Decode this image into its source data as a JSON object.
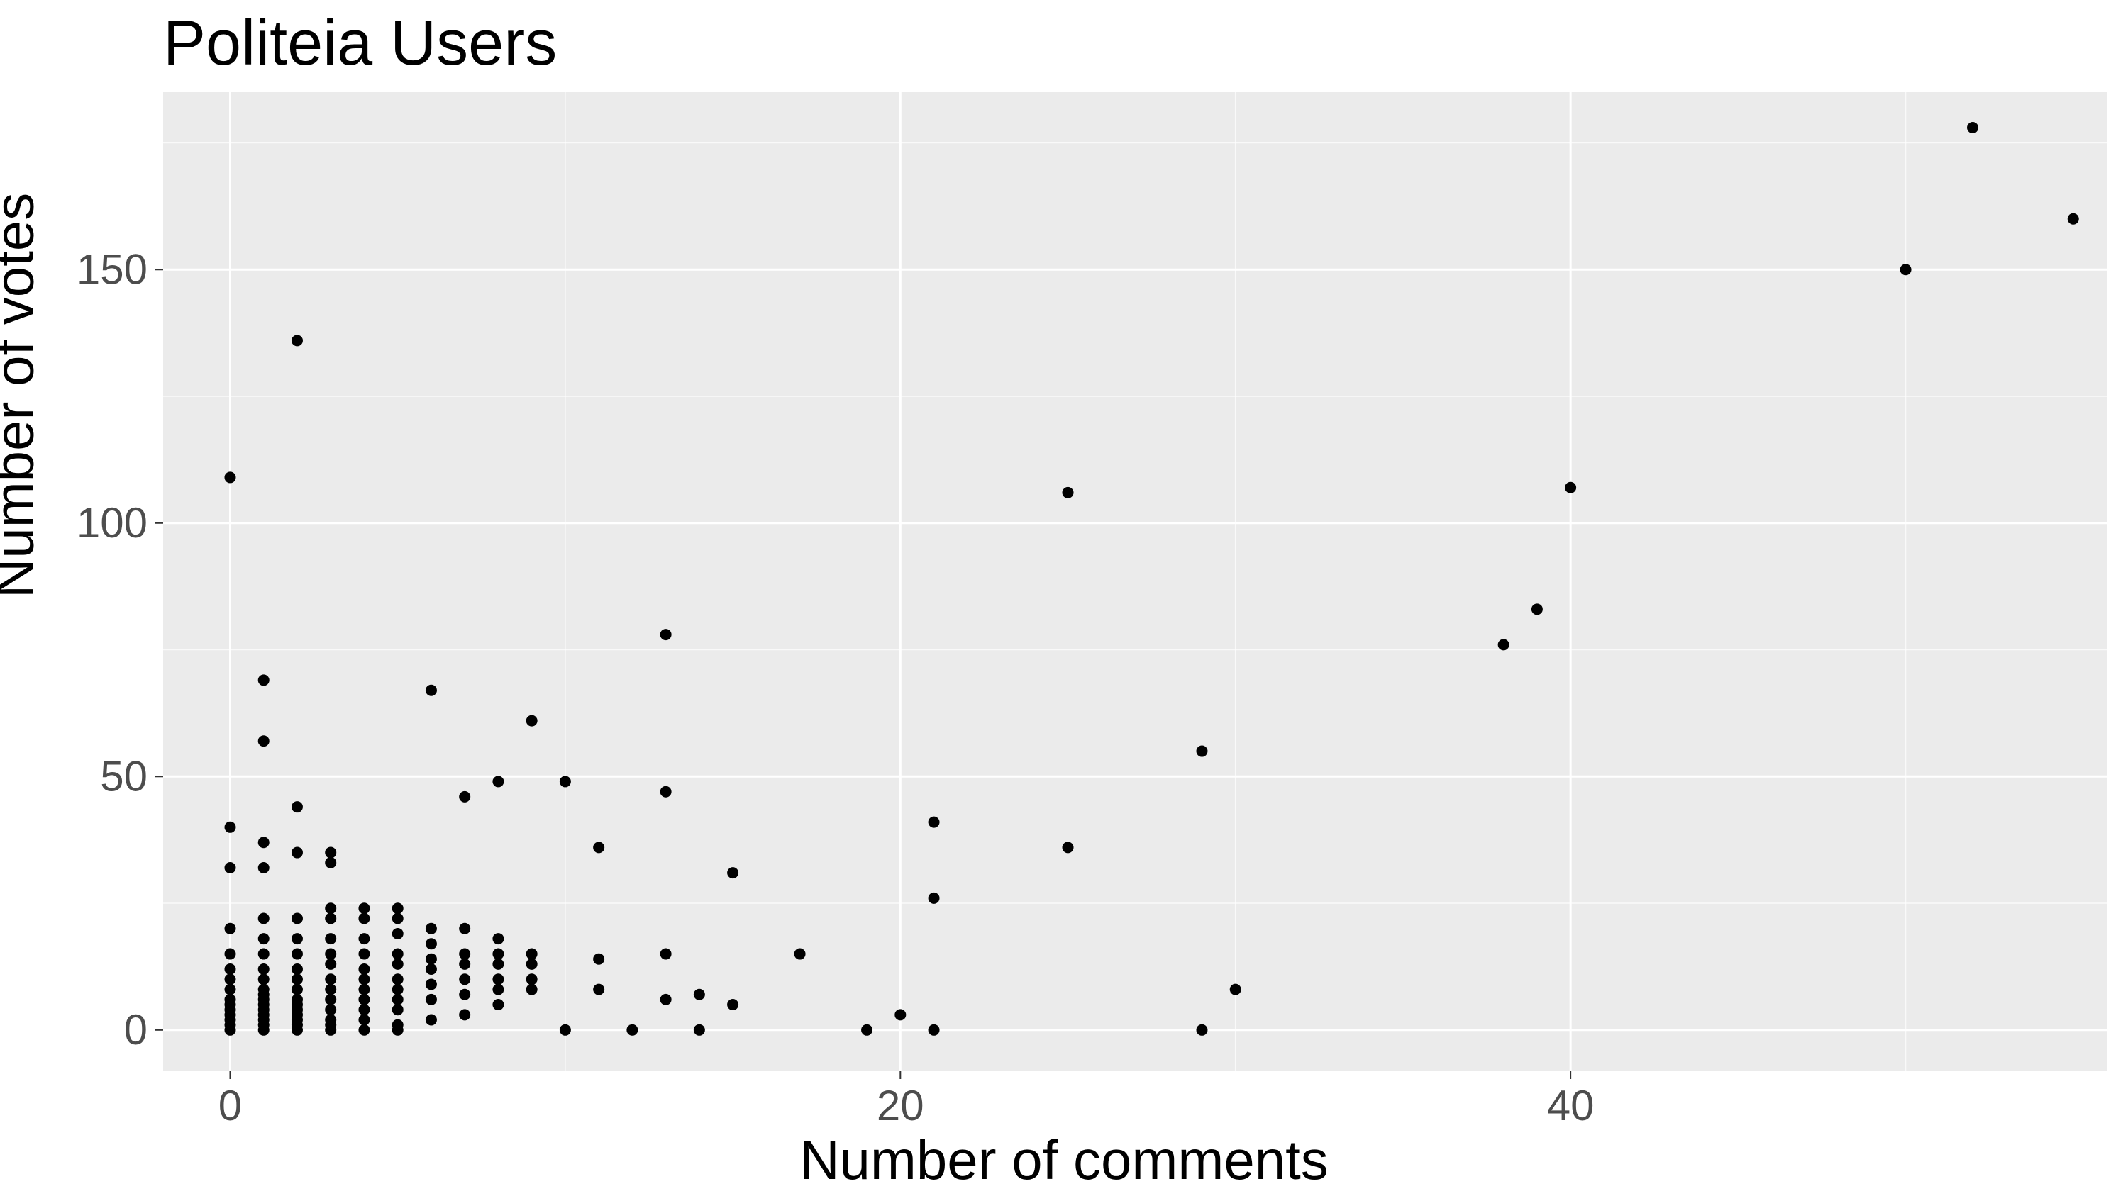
{
  "chart_data": {
    "type": "scatter",
    "title": "Politeia Users",
    "xlabel": "Number of comments",
    "ylabel": "Number of votes",
    "xlim": [
      -2,
      56
    ],
    "ylim": [
      -8,
      185
    ],
    "x_ticks": [
      0,
      20,
      40
    ],
    "y_ticks": [
      0,
      50,
      100,
      150
    ],
    "points": [
      {
        "x": 0,
        "y": 109
      },
      {
        "x": 0,
        "y": 40
      },
      {
        "x": 0,
        "y": 32
      },
      {
        "x": 0,
        "y": 20
      },
      {
        "x": 0,
        "y": 15
      },
      {
        "x": 0,
        "y": 12
      },
      {
        "x": 0,
        "y": 10
      },
      {
        "x": 0,
        "y": 8
      },
      {
        "x": 0,
        "y": 6
      },
      {
        "x": 0,
        "y": 5
      },
      {
        "x": 0,
        "y": 4
      },
      {
        "x": 0,
        "y": 3
      },
      {
        "x": 0,
        "y": 2
      },
      {
        "x": 0,
        "y": 1
      },
      {
        "x": 0,
        "y": 0
      },
      {
        "x": 1,
        "y": 69
      },
      {
        "x": 1,
        "y": 57
      },
      {
        "x": 1,
        "y": 37
      },
      {
        "x": 1,
        "y": 32
      },
      {
        "x": 1,
        "y": 22
      },
      {
        "x": 1,
        "y": 18
      },
      {
        "x": 1,
        "y": 15
      },
      {
        "x": 1,
        "y": 12
      },
      {
        "x": 1,
        "y": 10
      },
      {
        "x": 1,
        "y": 8
      },
      {
        "x": 1,
        "y": 7
      },
      {
        "x": 1,
        "y": 6
      },
      {
        "x": 1,
        "y": 5
      },
      {
        "x": 1,
        "y": 4
      },
      {
        "x": 1,
        "y": 3
      },
      {
        "x": 1,
        "y": 2
      },
      {
        "x": 1,
        "y": 1
      },
      {
        "x": 1,
        "y": 0
      },
      {
        "x": 2,
        "y": 136
      },
      {
        "x": 2,
        "y": 44
      },
      {
        "x": 2,
        "y": 35
      },
      {
        "x": 2,
        "y": 22
      },
      {
        "x": 2,
        "y": 18
      },
      {
        "x": 2,
        "y": 15
      },
      {
        "x": 2,
        "y": 12
      },
      {
        "x": 2,
        "y": 10
      },
      {
        "x": 2,
        "y": 8
      },
      {
        "x": 2,
        "y": 6
      },
      {
        "x": 2,
        "y": 5
      },
      {
        "x": 2,
        "y": 4
      },
      {
        "x": 2,
        "y": 3
      },
      {
        "x": 2,
        "y": 2
      },
      {
        "x": 2,
        "y": 1
      },
      {
        "x": 2,
        "y": 0
      },
      {
        "x": 3,
        "y": 35
      },
      {
        "x": 3,
        "y": 33
      },
      {
        "x": 3,
        "y": 24
      },
      {
        "x": 3,
        "y": 22
      },
      {
        "x": 3,
        "y": 18
      },
      {
        "x": 3,
        "y": 15
      },
      {
        "x": 3,
        "y": 13
      },
      {
        "x": 3,
        "y": 10
      },
      {
        "x": 3,
        "y": 8
      },
      {
        "x": 3,
        "y": 6
      },
      {
        "x": 3,
        "y": 4
      },
      {
        "x": 3,
        "y": 2
      },
      {
        "x": 3,
        "y": 1
      },
      {
        "x": 3,
        "y": 0
      },
      {
        "x": 4,
        "y": 24
      },
      {
        "x": 4,
        "y": 22
      },
      {
        "x": 4,
        "y": 18
      },
      {
        "x": 4,
        "y": 15
      },
      {
        "x": 4,
        "y": 12
      },
      {
        "x": 4,
        "y": 10
      },
      {
        "x": 4,
        "y": 8
      },
      {
        "x": 4,
        "y": 6
      },
      {
        "x": 4,
        "y": 4
      },
      {
        "x": 4,
        "y": 2
      },
      {
        "x": 4,
        "y": 0
      },
      {
        "x": 5,
        "y": 24
      },
      {
        "x": 5,
        "y": 22
      },
      {
        "x": 5,
        "y": 19
      },
      {
        "x": 5,
        "y": 15
      },
      {
        "x": 5,
        "y": 13
      },
      {
        "x": 5,
        "y": 10
      },
      {
        "x": 5,
        "y": 8
      },
      {
        "x": 5,
        "y": 6
      },
      {
        "x": 5,
        "y": 4
      },
      {
        "x": 5,
        "y": 1
      },
      {
        "x": 5,
        "y": 0
      },
      {
        "x": 6,
        "y": 67
      },
      {
        "x": 6,
        "y": 20
      },
      {
        "x": 6,
        "y": 17
      },
      {
        "x": 6,
        "y": 14
      },
      {
        "x": 6,
        "y": 12
      },
      {
        "x": 6,
        "y": 9
      },
      {
        "x": 6,
        "y": 6
      },
      {
        "x": 6,
        "y": 2
      },
      {
        "x": 7,
        "y": 46
      },
      {
        "x": 7,
        "y": 20
      },
      {
        "x": 7,
        "y": 15
      },
      {
        "x": 7,
        "y": 13
      },
      {
        "x": 7,
        "y": 10
      },
      {
        "x": 7,
        "y": 7
      },
      {
        "x": 7,
        "y": 3
      },
      {
        "x": 8,
        "y": 49
      },
      {
        "x": 8,
        "y": 18
      },
      {
        "x": 8,
        "y": 15
      },
      {
        "x": 8,
        "y": 13
      },
      {
        "x": 8,
        "y": 10
      },
      {
        "x": 8,
        "y": 8
      },
      {
        "x": 8,
        "y": 5
      },
      {
        "x": 9,
        "y": 61
      },
      {
        "x": 9,
        "y": 15
      },
      {
        "x": 9,
        "y": 13
      },
      {
        "x": 9,
        "y": 10
      },
      {
        "x": 9,
        "y": 8
      },
      {
        "x": 10,
        "y": 49
      },
      {
        "x": 10,
        "y": 0
      },
      {
        "x": 11,
        "y": 36
      },
      {
        "x": 11,
        "y": 14
      },
      {
        "x": 11,
        "y": 8
      },
      {
        "x": 12,
        "y": 0
      },
      {
        "x": 13,
        "y": 78
      },
      {
        "x": 13,
        "y": 47
      },
      {
        "x": 13,
        "y": 15
      },
      {
        "x": 13,
        "y": 6
      },
      {
        "x": 14,
        "y": 7
      },
      {
        "x": 14,
        "y": 0
      },
      {
        "x": 15,
        "y": 31
      },
      {
        "x": 15,
        "y": 5
      },
      {
        "x": 17,
        "y": 15
      },
      {
        "x": 19,
        "y": 0
      },
      {
        "x": 20,
        "y": 3
      },
      {
        "x": 21,
        "y": 41
      },
      {
        "x": 21,
        "y": 26
      },
      {
        "x": 21,
        "y": 0
      },
      {
        "x": 25,
        "y": 106
      },
      {
        "x": 25,
        "y": 36
      },
      {
        "x": 29,
        "y": 55
      },
      {
        "x": 29,
        "y": 0
      },
      {
        "x": 30,
        "y": 8
      },
      {
        "x": 38,
        "y": 76
      },
      {
        "x": 39,
        "y": 83
      },
      {
        "x": 40,
        "y": 107
      },
      {
        "x": 50,
        "y": 150
      },
      {
        "x": 52,
        "y": 178
      },
      {
        "x": 55,
        "y": 160
      }
    ]
  }
}
